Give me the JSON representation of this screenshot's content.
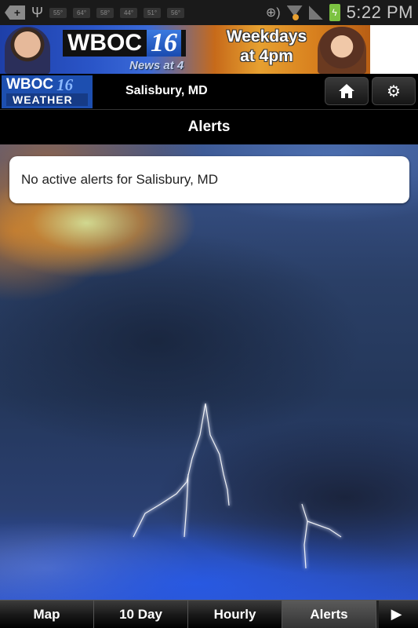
{
  "status_bar": {
    "temperatures": [
      "55°",
      "64°",
      "58°",
      "44°",
      "51°",
      "56°"
    ],
    "time": "5:22 PM",
    "icons": [
      "notification-add-icon",
      "usb-icon",
      "gps-icon",
      "wifi-icon",
      "signal-icon",
      "battery-charging-icon"
    ]
  },
  "ad": {
    "brand": "WBOC",
    "channel": "16",
    "subtitle": "News at 4",
    "tagline_line1": "Weekdays",
    "tagline_line2": "at 4pm"
  },
  "header": {
    "logo_brand": "WBOC",
    "logo_channel": "16",
    "logo_sub": "WEATHER",
    "location": "Salisbury, MD",
    "home_icon": "⌂",
    "settings_icon": "⚙"
  },
  "page": {
    "title": "Alerts",
    "alert_message": "No active alerts for Salisbury, MD"
  },
  "tabs": {
    "items": [
      {
        "label": "Map",
        "active": false
      },
      {
        "label": "10 Day",
        "active": false
      },
      {
        "label": "Hourly",
        "active": false
      },
      {
        "label": "Alerts",
        "active": true
      }
    ],
    "more_icon": "▶"
  }
}
